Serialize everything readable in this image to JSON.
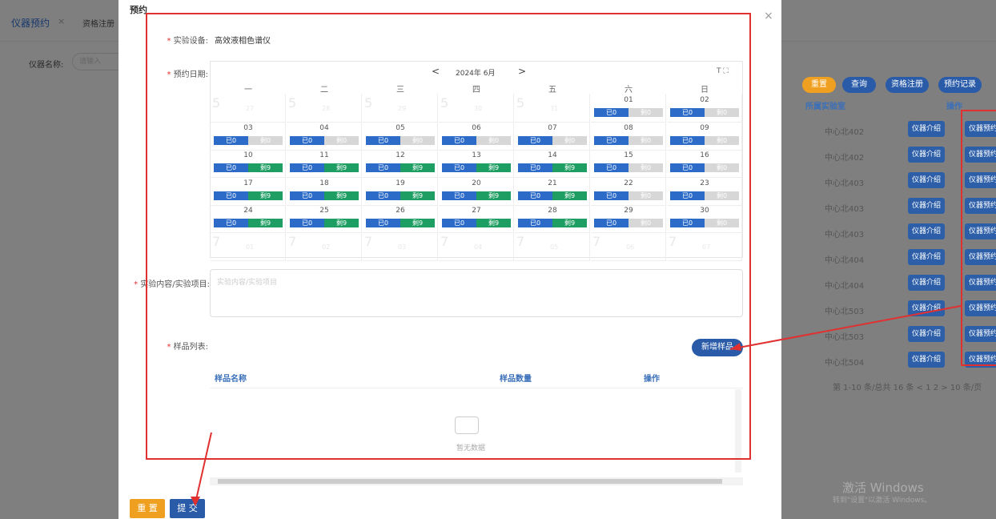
{
  "background": {
    "tab_active": "仪器预约",
    "tab_close": "×",
    "tab_second": "资格注册",
    "filter_label": "仪器名称:",
    "filter_placeholder": "请输入",
    "buttons": {
      "reset": "重置",
      "query": "查询",
      "register": "资格注册",
      "records": "预约记录"
    },
    "table_headers": {
      "lab": "所属实验室",
      "op": "操作"
    },
    "rows": [
      {
        "lab": "中心北402",
        "intro": "仪器介绍",
        "book": "仪器预约"
      },
      {
        "lab": "中心北402",
        "intro": "仪器介绍",
        "book": "仪器预约"
      },
      {
        "lab": "中心北403",
        "intro": "仪器介绍",
        "book": "仪器预约"
      },
      {
        "lab": "中心北403",
        "intro": "仪器介绍",
        "book": "仪器预约"
      },
      {
        "lab": "中心北403",
        "intro": "仪器介绍",
        "book": "仪器预约"
      },
      {
        "lab": "中心北404",
        "intro": "仪器介绍",
        "book": "仪器预约"
      },
      {
        "lab": "中心北404",
        "intro": "仪器介绍",
        "book": "仪器预约"
      },
      {
        "lab": "中心北503",
        "intro": "仪器介绍",
        "book": "仪器预约"
      },
      {
        "lab": "中心北503",
        "intro": "仪器介绍",
        "book": "仪器预约"
      },
      {
        "lab": "中心北504",
        "intro": "仪器介绍",
        "book": "仪器预约"
      }
    ],
    "pager": "第 1-10 条/总共 16 条 < 1 2 > 10 条/页",
    "watermark": "激活 Windows",
    "watermark2": "转到\"设置\"以激活 Windows。"
  },
  "modal": {
    "title": "预约",
    "close": "×",
    "device_label": "实验设备:",
    "device_value": "高效液相色谱仪",
    "date_label": "预约日期:",
    "calendar": {
      "prev": "<",
      "year_month": "2024年  6月",
      "next": ">",
      "tools": "T ⛶",
      "weekdays": [
        "一",
        "二",
        "三",
        "四",
        "五",
        "六",
        "日"
      ],
      "days": [
        {
          "n": "27",
          "ghost": true
        },
        {
          "n": "28",
          "ghost": true
        },
        {
          "n": "29",
          "ghost": true
        },
        {
          "n": "30",
          "ghost": true
        },
        {
          "n": "31",
          "ghost": true
        },
        {
          "n": "01",
          "a": "已0",
          "b": "剩0",
          "ok": false
        },
        {
          "n": "02",
          "a": "已0",
          "b": "剩0",
          "ok": false
        },
        {
          "n": "03",
          "a": "已0",
          "b": "剩0",
          "ok": false
        },
        {
          "n": "04",
          "a": "已0",
          "b": "剩0",
          "ok": false
        },
        {
          "n": "05",
          "a": "已0",
          "b": "剩0",
          "ok": false
        },
        {
          "n": "06",
          "a": "已0",
          "b": "剩0",
          "ok": false
        },
        {
          "n": "07",
          "a": "已0",
          "b": "剩0",
          "ok": false
        },
        {
          "n": "08",
          "a": "已0",
          "b": "剩0",
          "ok": false
        },
        {
          "n": "09",
          "a": "已0",
          "b": "剩0",
          "ok": false
        },
        {
          "n": "10",
          "a": "已0",
          "b": "剩9",
          "ok": true
        },
        {
          "n": "11",
          "a": "已0",
          "b": "剩9",
          "ok": true
        },
        {
          "n": "12",
          "a": "已0",
          "b": "剩9",
          "ok": true
        },
        {
          "n": "13",
          "a": "已0",
          "b": "剩9",
          "ok": true
        },
        {
          "n": "14",
          "a": "已0",
          "b": "剩9",
          "ok": true
        },
        {
          "n": "15",
          "a": "已0",
          "b": "剩0",
          "ok": false
        },
        {
          "n": "16",
          "a": "已0",
          "b": "剩0",
          "ok": false
        },
        {
          "n": "17",
          "a": "已0",
          "b": "剩9",
          "ok": true
        },
        {
          "n": "18",
          "a": "已0",
          "b": "剩9",
          "ok": true
        },
        {
          "n": "19",
          "a": "已0",
          "b": "剩9",
          "ok": true
        },
        {
          "n": "20",
          "a": "已0",
          "b": "剩9",
          "ok": true
        },
        {
          "n": "21",
          "a": "已0",
          "b": "剩9",
          "ok": true
        },
        {
          "n": "22",
          "a": "已0",
          "b": "剩0",
          "ok": false
        },
        {
          "n": "23",
          "a": "已0",
          "b": "剩0",
          "ok": false
        },
        {
          "n": "24",
          "a": "已0",
          "b": "剩9",
          "ok": true
        },
        {
          "n": "25",
          "a": "已0",
          "b": "剩9",
          "ok": true
        },
        {
          "n": "26",
          "a": "已0",
          "b": "剩9",
          "ok": true
        },
        {
          "n": "27",
          "a": "已0",
          "b": "剩9",
          "ok": true
        },
        {
          "n": "28",
          "a": "已0",
          "b": "剩9",
          "ok": true
        },
        {
          "n": "29",
          "a": "已0",
          "b": "剩0",
          "ok": false
        },
        {
          "n": "30",
          "a": "已0",
          "b": "剩0",
          "ok": false
        },
        {
          "n": "01",
          "ghost": true
        },
        {
          "n": "02",
          "ghost": true
        },
        {
          "n": "03",
          "ghost": true
        },
        {
          "n": "04",
          "ghost": true
        },
        {
          "n": "05",
          "ghost": true
        },
        {
          "n": "06",
          "ghost": true
        },
        {
          "n": "07",
          "ghost": true
        }
      ],
      "ghost_prefix_top": "5",
      "ghost_prefix_bottom": "7"
    },
    "content_label": "实验内容/实验项目:",
    "content_placeholder": "实验内容/实验项目",
    "sample_label": "样品列表:",
    "add_sample": "新增样品",
    "sample_headers": {
      "name": "样品名称",
      "qty": "样品数量",
      "op": "操作"
    },
    "empty": "暂无数据",
    "reset": "重 置",
    "submit": "提 交"
  },
  "colors": {
    "primary": "#2a5ba8",
    "warning": "#f0a020",
    "success": "#1e9e62",
    "annotation": "#e03030"
  }
}
